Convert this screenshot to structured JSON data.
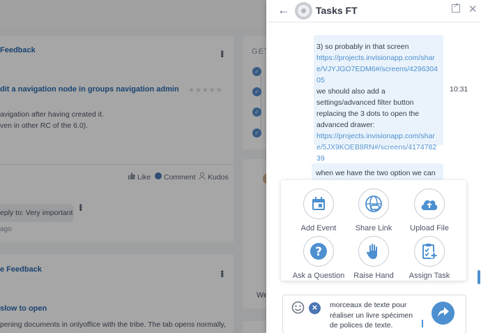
{
  "background": {
    "feed": {
      "post1": {
        "category": "Feedback",
        "title": "dit a navigation node in groups navigation admin",
        "line1": "avigation after having created it.",
        "line2": "ven in other RC of the 6.0).",
        "like_label": "Like",
        "comment_label": "Comment",
        "kudos_label": "Kudos",
        "reply_text": "eply to: Very important",
        "reply_age": "ago"
      },
      "post2": {
        "category": "e Feedback",
        "title": "slow to open",
        "line1": "pening documents in onlyoffice with the tribe.  The tab opens normally,"
      }
    },
    "sidebar": {
      "get_label": "GET",
      "we_label": "We"
    }
  },
  "chat": {
    "room_name": "Tasks FT",
    "messages": [
      {
        "text_before": "3) so probably in that screen",
        "link1": "https://projects.invisionapp.com/share/VJYJGO7EDM6#/screens/429630405",
        "text_middle": "we should also add a settings/advanced filter button replacing the 3 dots to open the advanced drawer:",
        "link2": "https://projects.invisionapp.com/share/5JX9KOEB8RN#/screens/417478239",
        "time": "10:31"
      },
      {
        "text": "when we have the two option we can"
      }
    ],
    "actions": [
      {
        "label": "Add Event",
        "icon": "calendar-icon"
      },
      {
        "label": "Share Link",
        "icon": "link-icon"
      },
      {
        "label": "Upload File",
        "icon": "cloud-upload-icon"
      },
      {
        "label": "Ask a Question",
        "icon": "question-icon"
      },
      {
        "label": "Raise Hand",
        "icon": "hand-icon"
      },
      {
        "label": "Assign Task",
        "icon": "task-icon"
      }
    ],
    "composer": {
      "value": "morceaux de texte pour\nréaliser un livre spécimen\nde polices de texte."
    }
  },
  "colors": {
    "accent": "#4d90d0",
    "bubble": "#eaf3fb",
    "link": "#4d90d0"
  }
}
